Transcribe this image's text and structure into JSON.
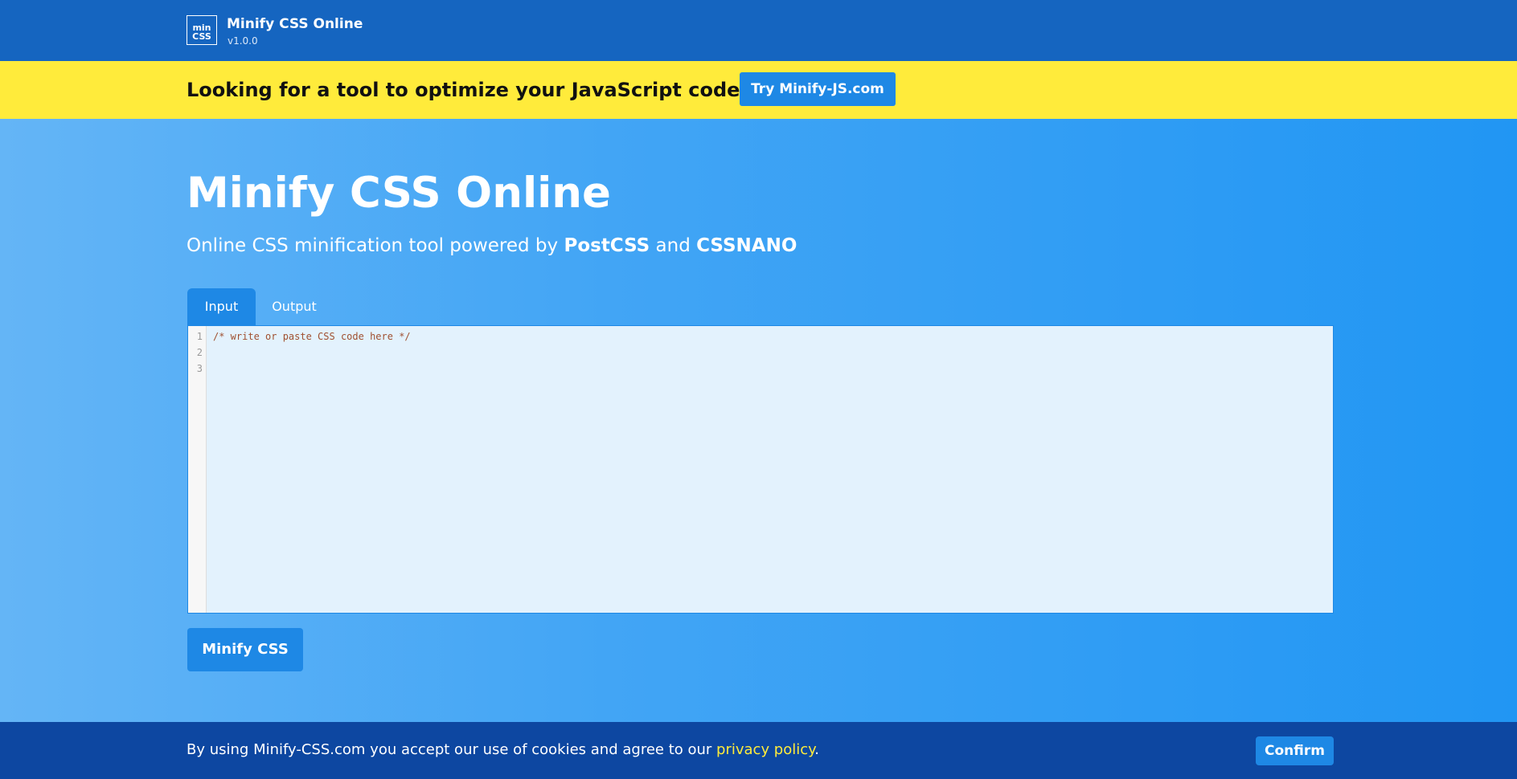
{
  "header": {
    "logo_line1": "min",
    "logo_line2": "CSS",
    "title": "Minify CSS Online",
    "version": "v1.0.0"
  },
  "promo": {
    "text": "Looking for a tool to optimize your JavaScript code?",
    "button_label": "Try Minify-JS.com"
  },
  "hero": {
    "title": "Minify CSS Online",
    "subtitle_prefix": "Online CSS minification tool powered by ",
    "subtitle_strong1": "PostCSS",
    "subtitle_mid": " and ",
    "subtitle_strong2": "CSSNANO"
  },
  "tabs": [
    {
      "label": "Input",
      "active": true
    },
    {
      "label": "Output",
      "active": false
    }
  ],
  "editor": {
    "line_numbers": [
      "1",
      "2",
      "3"
    ],
    "lines": [
      "/* write or paste CSS code here */",
      "",
      ""
    ]
  },
  "actions": {
    "minify_label": "Minify CSS"
  },
  "cookie": {
    "text_prefix": "By using Minify-CSS.com you accept our use of cookies and agree to our ",
    "link_text": "privacy policy",
    "text_suffix": ".",
    "confirm_label": "Confirm"
  },
  "colors": {
    "header_bg": "#1565c0",
    "promo_bg": "#ffeb3b",
    "accent": "#1e88e5",
    "cookie_bg": "#0d47a1"
  }
}
